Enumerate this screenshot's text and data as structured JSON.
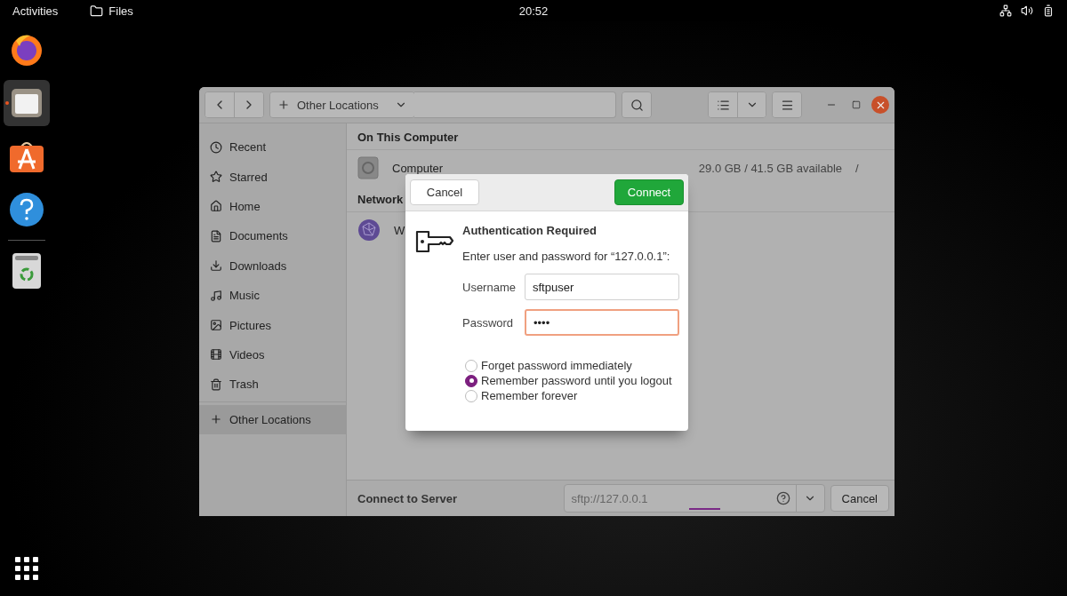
{
  "top_bar": {
    "activities": "Activities",
    "app": {
      "label": "Files"
    },
    "clock": "20:52"
  },
  "dock": {
    "items": [
      {
        "kind": "firefox",
        "selected": false,
        "running": false
      },
      {
        "kind": "files",
        "selected": true,
        "running": true
      },
      {
        "kind": "store",
        "selected": false,
        "running": false
      },
      {
        "kind": "help",
        "selected": false,
        "running": false
      },
      {
        "kind": "trash",
        "selected": false,
        "running": false
      }
    ]
  },
  "window": {
    "path": {
      "label": "Other Locations"
    },
    "sidebar": {
      "items": [
        {
          "label": "Recent",
          "selected": false
        },
        {
          "label": "Starred",
          "selected": false
        },
        {
          "label": "Home",
          "selected": false
        },
        {
          "label": "Documents",
          "selected": false
        },
        {
          "label": "Downloads",
          "selected": false
        },
        {
          "label": "Music",
          "selected": false
        },
        {
          "label": "Pictures",
          "selected": false
        },
        {
          "label": "Videos",
          "selected": false
        },
        {
          "label": "Trash",
          "selected": false
        },
        {
          "label": "Other Locations",
          "selected": true
        }
      ]
    },
    "sections": [
      {
        "title": "On This Computer",
        "rows": [
          {
            "kind": "disk",
            "name": "Computer",
            "info": "29.0 GB / 41.5 GB available",
            "mount": "/"
          }
        ]
      },
      {
        "title": "Network",
        "rows": [
          {
            "kind": "network",
            "name": "W"
          }
        ]
      }
    ],
    "connect_bar": {
      "label": "Connect to Server",
      "address": {
        "placeholder": "sftp://127.0.0.1"
      },
      "cancel": "Cancel"
    }
  },
  "dialog": {
    "cancel": "Cancel",
    "connect": "Connect",
    "title": "Authentication Required",
    "message": "Enter user and password for “127.0.0.1”:",
    "fields": [
      {
        "label": "Username",
        "value": "sftpuser",
        "focused": false
      },
      {
        "label": "Password",
        "value": "••••",
        "focused": true
      }
    ],
    "options": [
      {
        "label": "Forget password immediately",
        "selected": false
      },
      {
        "label": "Remember password until you logout",
        "selected": true
      },
      {
        "label": "Remember forever",
        "selected": false
      }
    ]
  }
}
